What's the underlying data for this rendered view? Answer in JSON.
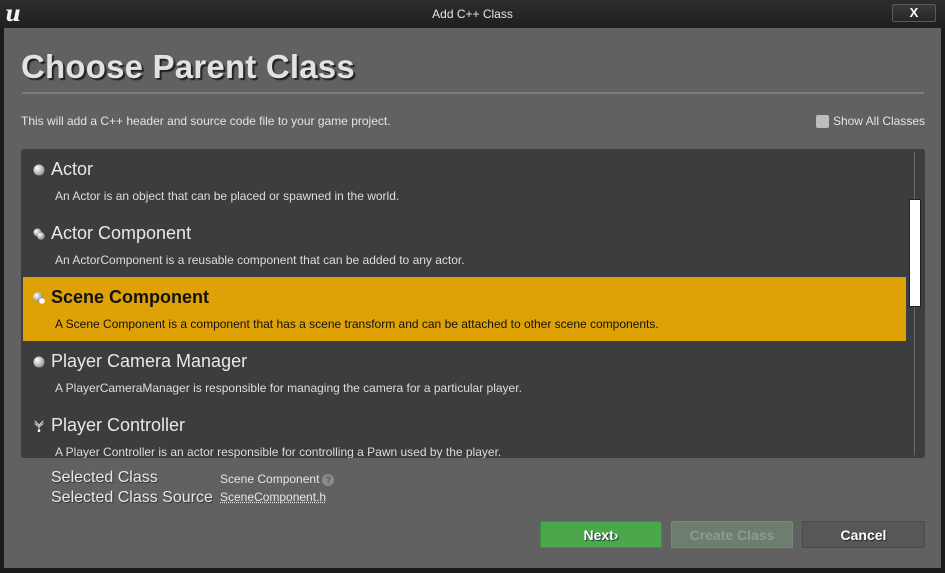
{
  "window": {
    "title": "Add C++ Class",
    "close_label": "X",
    "logo": "unreal-engine-logo"
  },
  "header": {
    "title": "Choose Parent Class",
    "subtitle": "This will add a C++ header and source code file to your game project."
  },
  "options": {
    "show_all_classes_label": "Show All Classes",
    "show_all_classes_checked": false
  },
  "class_list": {
    "selected_index": 2,
    "items": [
      {
        "name": "Actor",
        "description": "An Actor is an object that can be placed or spawned in the world.",
        "icon": "actor-sphere-icon"
      },
      {
        "name": "Actor Component",
        "description": "An ActorComponent is a reusable component that can be added to any actor.",
        "icon": "actor-component-icon"
      },
      {
        "name": "Scene Component",
        "description": "A Scene Component is a component that has a scene transform and can be attached to other scene components.",
        "icon": "scene-component-icon"
      },
      {
        "name": "Player Camera Manager",
        "description": "A PlayerCameraManager is responsible for managing the camera for a particular player.",
        "icon": "actor-sphere-icon"
      },
      {
        "name": "Player Controller",
        "description": "A Player Controller is an actor responsible for controlling a Pawn used by the player.",
        "icon": "player-controller-icon"
      }
    ]
  },
  "selection_info": {
    "class_label": "Selected Class",
    "class_value": "Scene Component",
    "source_label": "Selected Class Source",
    "source_value": "SceneComponent.h"
  },
  "buttons": {
    "next": "Next",
    "next_glyph": "›",
    "create": "Create Class",
    "cancel": "Cancel"
  },
  "colors": {
    "selected_row": "#dfa206",
    "next_button": "#4aa84a"
  }
}
